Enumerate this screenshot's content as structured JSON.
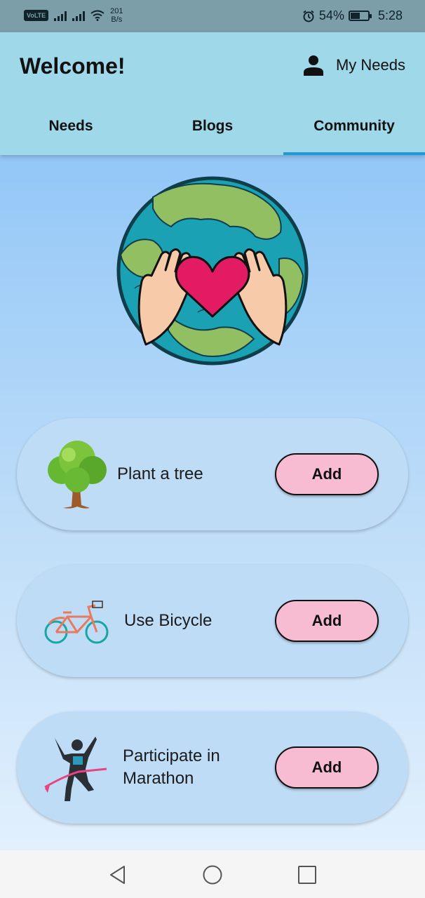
{
  "status_bar": {
    "volte": "VoLTE",
    "net_speed_value": "201",
    "net_speed_unit": "B/s",
    "battery_percent": "54%",
    "battery_level": 0.54,
    "time": "5:28",
    "icons": [
      "signal-icon",
      "wifi-icon",
      "alarm-icon",
      "battery-icon"
    ]
  },
  "app_bar": {
    "title": "Welcome!",
    "my_needs_label": "My Needs",
    "person_icon": "person-icon"
  },
  "tabs": [
    {
      "label": "Needs",
      "active": false
    },
    {
      "label": "Blogs",
      "active": false
    },
    {
      "label": "Community",
      "active": true
    }
  ],
  "hero": {
    "icon": "earth-with-heart-hands"
  },
  "cards": [
    {
      "label": "Plant a tree",
      "icon": "tree-icon",
      "button": "Add"
    },
    {
      "label": "Use Bicycle",
      "icon": "bicycle-icon",
      "button": "Add"
    },
    {
      "label": "Participate in Marathon",
      "icon": "runner-icon",
      "button": "Add"
    }
  ],
  "nav_bar": {
    "icons": [
      "back-icon",
      "home-icon",
      "recents-icon"
    ]
  },
  "colors": {
    "app_bar": "#9fd8e8",
    "tab_indicator": "#1f9ad6",
    "card": "#bfdcf7",
    "button": "#f8bcd2",
    "status_bar": "#7b9ea9"
  }
}
